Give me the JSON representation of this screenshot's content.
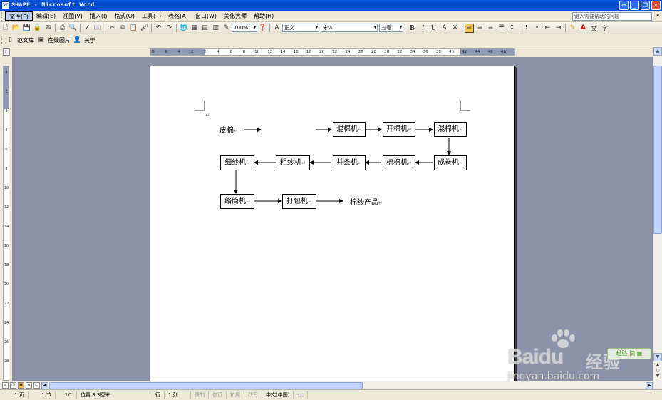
{
  "window": {
    "title": "SHAPE - Microsoft Word",
    "app_icon": "W",
    "controls": {
      "swap": "⇔",
      "minimize": "_",
      "restore": "❐",
      "close": "✕"
    }
  },
  "menubar": {
    "items": [
      "文件(F)",
      "编辑(E)",
      "视图(V)",
      "插入(I)",
      "格式(O)",
      "工具(T)",
      "表格(A)",
      "窗口(W)",
      "美化大师",
      "帮助(H)"
    ],
    "help_placeholder": "键入需要帮助的问题"
  },
  "toolbar1": {
    "zoom": "100%",
    "style": "正文",
    "font": "宋体",
    "size": "五号",
    "bold": "B",
    "italic": "I",
    "underline": "U",
    "char_border": "A"
  },
  "toolbar2": {
    "template_library": "范文库",
    "online_images": "在线图片",
    "about": "关于"
  },
  "ruler": {
    "tab_selector": "L",
    "h_labels": [
      "8",
      "6",
      "4",
      "2",
      "2",
      "4",
      "6",
      "8",
      "10",
      "12",
      "14",
      "16",
      "18",
      "20",
      "22",
      "24",
      "26",
      "28",
      "30",
      "32",
      "34",
      "36",
      "38",
      "40",
      "42",
      "44",
      "46",
      "48"
    ],
    "v_labels": [
      "4",
      "2",
      "2",
      "4",
      "6",
      "8",
      "10",
      "12",
      "14",
      "16",
      "18",
      "20",
      "22",
      "24",
      "26",
      "28"
    ]
  },
  "flowchart": {
    "start_text": "皮棉",
    "paragraph_mark": "↵",
    "row1": [
      "混棉机",
      "开棉机",
      "混棉机"
    ],
    "row2": [
      "成卷机",
      "梳棉机",
      "并条机",
      "粗纱机",
      "细纱机"
    ],
    "row3": [
      "络筒机",
      "打包机"
    ],
    "end_text": "棉纱产品"
  },
  "statusbar": {
    "page": "1 页",
    "section": "1 节",
    "page_of": "1/1",
    "position": "位置 3.3厘米",
    "line": "行",
    "column": "1 列",
    "record": "录制",
    "revise": "修订",
    "extend": "扩展",
    "overwrite": "改写",
    "language": "中文(中国)"
  },
  "watermark": {
    "brand": "Baidu",
    "cn": "经验",
    "url": "jingyan.baidu.com",
    "badge": "经验 简 ▦"
  },
  "colors": {
    "titlebar": "#0a4fd8",
    "workspace": "#8c92a8",
    "menubar": "#ece9d8"
  }
}
